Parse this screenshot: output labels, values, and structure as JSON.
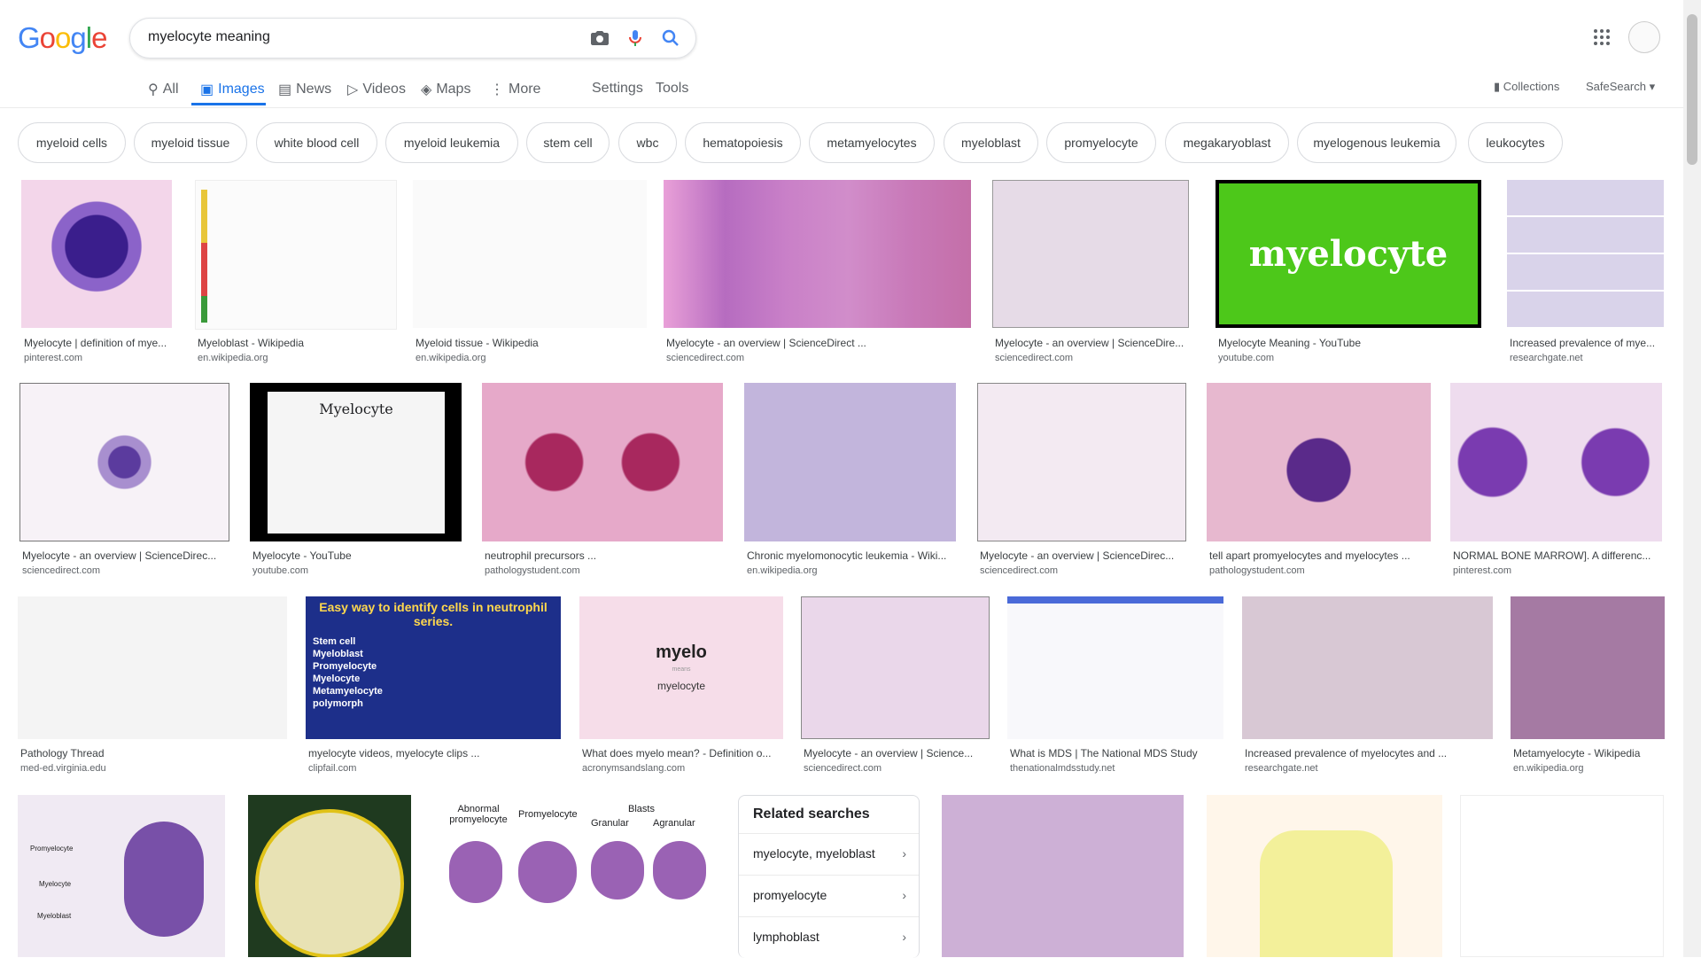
{
  "logo": {
    "g1": "G",
    "o1": "o",
    "o2": "o",
    "g2": "g",
    "l": "l",
    "e": "e"
  },
  "search": {
    "query": "myelocyte meaning"
  },
  "tabs": [
    {
      "label": "All",
      "icon": "search-icon"
    },
    {
      "label": "Images",
      "icon": "image-icon"
    },
    {
      "label": "News",
      "icon": "news-icon"
    },
    {
      "label": "Videos",
      "icon": "video-icon"
    },
    {
      "label": "Maps",
      "icon": "map-icon"
    },
    {
      "label": "More",
      "icon": "more-vert-icon"
    }
  ],
  "tools": {
    "settings": "Settings",
    "tools": "Tools"
  },
  "right": {
    "collections": "Collections",
    "safesearch": "SafeSearch"
  },
  "chips": [
    "myeloid cells",
    "myeloid tissue",
    "white blood cell",
    "myeloid leukemia",
    "stem cell",
    "wbc",
    "hematopoiesis",
    "metamyelocytes",
    "myeloblast",
    "promyelocyte",
    "megakaryoblast",
    "myelogenous leukemia",
    "leukocytes"
  ],
  "results": [
    {
      "title": "Myelocyte | definition of mye...",
      "source": "pinterest.com"
    },
    {
      "title": "Myeloblast - Wikipedia",
      "source": "en.wikipedia.org"
    },
    {
      "title": "Myeloid tissue - Wikipedia",
      "source": "en.wikipedia.org"
    },
    {
      "title": "Myelocyte - an overview | ScienceDirect ...",
      "source": "sciencedirect.com"
    },
    {
      "title": "Myelocyte - an overview | ScienceDire...",
      "source": "sciencedirect.com"
    },
    {
      "title": "Myelocyte Meaning - YouTube",
      "source": "youtube.com"
    },
    {
      "title": "Increased prevalence of mye...",
      "source": "researchgate.net"
    },
    {
      "title": "Myelocyte - an overview | ScienceDirec...",
      "source": "sciencedirect.com"
    },
    {
      "title": "Myelocyte - YouTube",
      "source": "youtube.com"
    },
    {
      "title": "neutrophil precursors ...",
      "source": "pathologystudent.com"
    },
    {
      "title": "Chronic myelomonocytic leukemia - Wiki...",
      "source": "en.wikipedia.org"
    },
    {
      "title": "Myelocyte - an overview | ScienceDirec...",
      "source": "sciencedirect.com"
    },
    {
      "title": "tell apart promyelocytes and myelocytes ...",
      "source": "pathologystudent.com"
    },
    {
      "title": "NORMAL BONE MARROW]. A differenc...",
      "source": "pinterest.com"
    },
    {
      "title": "Pathology Thread",
      "source": "med-ed.virginia.edu"
    },
    {
      "title": "myelocyte videos, myelocyte clips ...",
      "source": "clipfail.com"
    },
    {
      "title": "What does myelo mean? - Definition o...",
      "source": "acronymsandslang.com"
    },
    {
      "title": "Myelocyte - an overview | Science...",
      "source": "sciencedirect.com"
    },
    {
      "title": "What is MDS | The National MDS Study",
      "source": "thenationalmdsstudy.net"
    },
    {
      "title": "Increased prevalence of myelocytes and ...",
      "source": "researchgate.net"
    },
    {
      "title": "Metamyelocyte - Wikipedia",
      "source": "en.wikipedia.org"
    }
  ],
  "thumb_text": {
    "myelocyte_banner": "myelocyte",
    "yt_title": "Myelocyte",
    "clip_title": "Easy way to identify cells in neutrophil series.",
    "clip_list": [
      "Stem cell",
      "Myeloblast",
      "Promyelocyte",
      "Myelocyte",
      "Metamyelocyte",
      "polymorph"
    ],
    "acro_word": "myelo",
    "acro_means": "means",
    "acro_def": "myelocyte",
    "row4_headers": [
      "Abnormal promyelocyte",
      "Promyelocyte",
      "Blasts",
      "Granular",
      "Agranular"
    ],
    "row4_labels": [
      "Promyelocyte",
      "Myelocyte",
      "Myeloblast"
    ]
  },
  "related": {
    "heading": "Related searches",
    "items": [
      "myelocyte, myeloblast",
      "promyelocyte",
      "lymphoblast"
    ]
  },
  "colors": {
    "accent": "#1a73e8",
    "blue": "#4285f4",
    "red": "#ea4335",
    "yellow": "#fbbc05",
    "green": "#34a853"
  }
}
